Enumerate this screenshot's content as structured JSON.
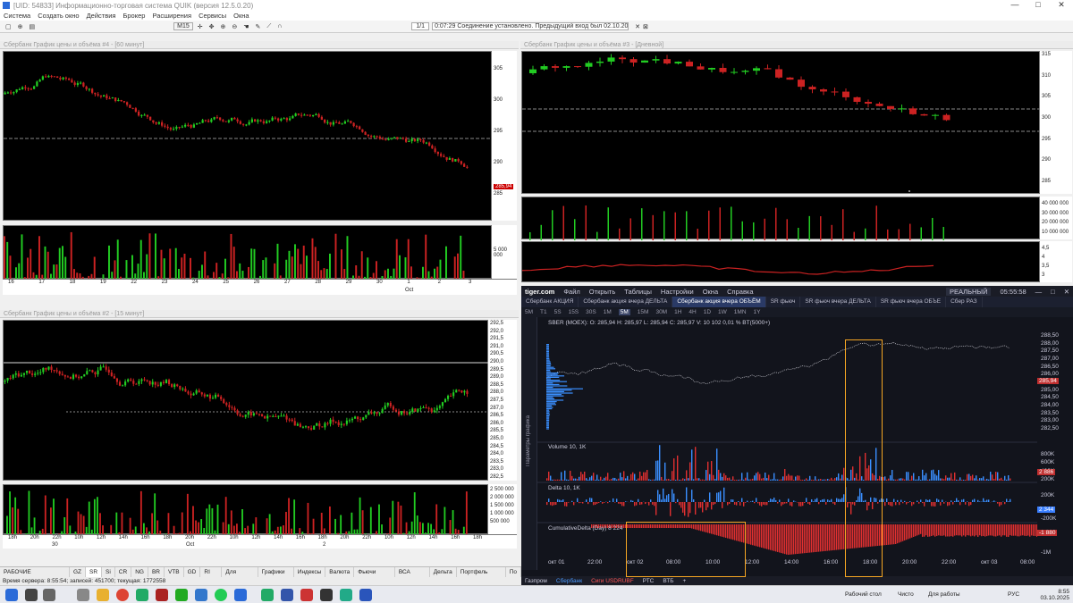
{
  "window": {
    "title": "[UID: 54833] Информационно-торговая система QUIK (версия 12.5.0.20)",
    "controls": [
      "—",
      "□",
      "✕"
    ]
  },
  "menu": [
    "Система",
    "Создать окно",
    "Действия",
    "Брокер",
    "Расширения",
    "Сервисы",
    "Окна"
  ],
  "toolbar": {
    "timeframe": "M15",
    "counter": "1/1",
    "connection": "0:07:29  Соединение установлено. Предыдущий вход был 02.10.2025 8:05:36 с"
  },
  "panels": [
    {
      "title": "Сбербанк График цены и объёма #4 - [60 минут]",
      "price": "285,94",
      "yticks": [
        "305",
        "300",
        "295",
        "290",
        "285"
      ],
      "vticks": [
        "5 000 000"
      ],
      "xticks": [
        "16",
        "17",
        "18",
        "19",
        "22",
        "23",
        "24",
        "25",
        "26",
        "27",
        "28",
        "29",
        "30",
        "1",
        "2",
        "3"
      ],
      "month": "Oct"
    },
    {
      "title": "Сбербанк График цены и объёма #3 - [Дневной]",
      "price": "285,94",
      "yticks": [
        "315",
        "310",
        "305",
        "300",
        "295",
        "290",
        "285"
      ],
      "vticks": [
        "40 000 000",
        "30 000 000",
        "20 000 000",
        "10 000 000"
      ],
      "iticks": [
        "4,5",
        "4",
        "3,5",
        "3"
      ]
    },
    {
      "title": "Сбербанк График цены и объёма #2 - [15 минут]",
      "price": "285,94",
      "yticks": [
        "292,5",
        "292,0",
        "291,5",
        "291,0",
        "290,5",
        "290,0",
        "289,5",
        "289,0",
        "288,5",
        "288,0",
        "287,5",
        "287,0",
        "286,5",
        "286,0",
        "285,5",
        "285,0",
        "284,5",
        "284,0",
        "283,5",
        "283,0",
        "282,5"
      ],
      "vticks": [
        "2 500 000",
        "2 000 000",
        "1 500 000",
        "1 000 000",
        "500 000"
      ],
      "xticks": [
        "18h",
        "20h",
        "22h",
        "10h",
        "12h",
        "14h",
        "16h",
        "18h",
        "20h",
        "22h",
        "10h",
        "12h",
        "14h",
        "16h",
        "18h",
        "20h",
        "22h",
        "10h",
        "12h",
        "14h",
        "16h",
        "18h"
      ],
      "days": [
        "30",
        "Oct",
        "2"
      ]
    }
  ],
  "tiger": {
    "logo": "tiger.com",
    "menu": [
      "Файл",
      "Открыть",
      "Таблицы",
      "Настройки",
      "Окна",
      "Справка"
    ],
    "mode": "РЕАЛЬНЫЙ",
    "time": "05:55:58",
    "tabs": [
      "Сбербанк АКЦИЯ",
      "Сбербанк акция вчера ДЕЛЬТА",
      "Сбербанк акция вчера ОБЪЁМ",
      "SR фьюч",
      "SR фьюч вчера ДЕЛЬТА",
      "SR фьюч вчера ОБЪЕ",
      "Сбер РАЗ"
    ],
    "active_tab": "Сбербанк акция вчера ОБЪЁМ",
    "timeframes": [
      "5M",
      "T1",
      "5S",
      "15S",
      "30S",
      "1M",
      "5M",
      "15M",
      "30M",
      "1H",
      "4H",
      "1D",
      "1W",
      "1MN",
      "1Y"
    ],
    "active_tf": "5M",
    "ohlc": "SBER (MOEX): O: 285,94  H: 285,97  L: 285,94  C: 285,97  V: 10 102  0,01 %  BT(5000+)",
    "yticks": [
      "288,50",
      "288,00",
      "287,50",
      "287,00",
      "286,50",
      "286,00",
      "285,50",
      "285,00",
      "284,50",
      "284,00",
      "283,50",
      "283,00",
      "282,50"
    ],
    "price": "285,94",
    "volume_label": "Volume  10, 1K",
    "volume_ticks": [
      "800K",
      "600K",
      "400K",
      "200K"
    ],
    "volume_last": "2 886",
    "delta_label": "Delta  10, 1K",
    "delta_ticks": [
      "200K",
      "-200K"
    ],
    "delta_last": "2 344",
    "cum_label": "CumulativeDelta (Day)  8 224",
    "cum_ticks": [
      "-1M"
    ],
    "cum_last": "-1 880",
    "xticks": [
      "окт 01",
      "22:00",
      "окт 02",
      "08:00",
      "10:00",
      "12:00",
      "14:00",
      "16:00",
      "18:00",
      "20:00",
      "22:00",
      "окт 03",
      "08:00"
    ],
    "side_label": "Параметры графика",
    "bottom": [
      "Газпром",
      "Сбербанк",
      "Сиги USDRUBF",
      "РТС",
      "ВТБ",
      "+"
    ]
  },
  "bottom_tabs": [
    "РАБОЧИЕ ИНСТРУМЕНТЫ",
    "GZ",
    "SR",
    "Si",
    "CR",
    "NG",
    "BR",
    "VTB",
    "GD",
    "RI MX",
    "Для скринов",
    "Графики МБ",
    "Индексы",
    "Валюта",
    "Фьючи разные",
    "ВСА уровни",
    "Дельта",
    "Портфель ФОРТС",
    "По"
  ],
  "status": "Время сервера: 8:55:54; записей: 451700; текущая: 1772558",
  "taskbar": {
    "items": [
      "Рабочий стол",
      "Чисто",
      "Для работы"
    ],
    "lang": "РУС",
    "clock": "8:55",
    "date": "03.10.2025"
  },
  "colors": {
    "up": "#22cc22",
    "down": "#cc2222",
    "bg": "#000000",
    "accent": "#f5a623",
    "blue": "#3a8fff",
    "red": "#e03030"
  }
}
